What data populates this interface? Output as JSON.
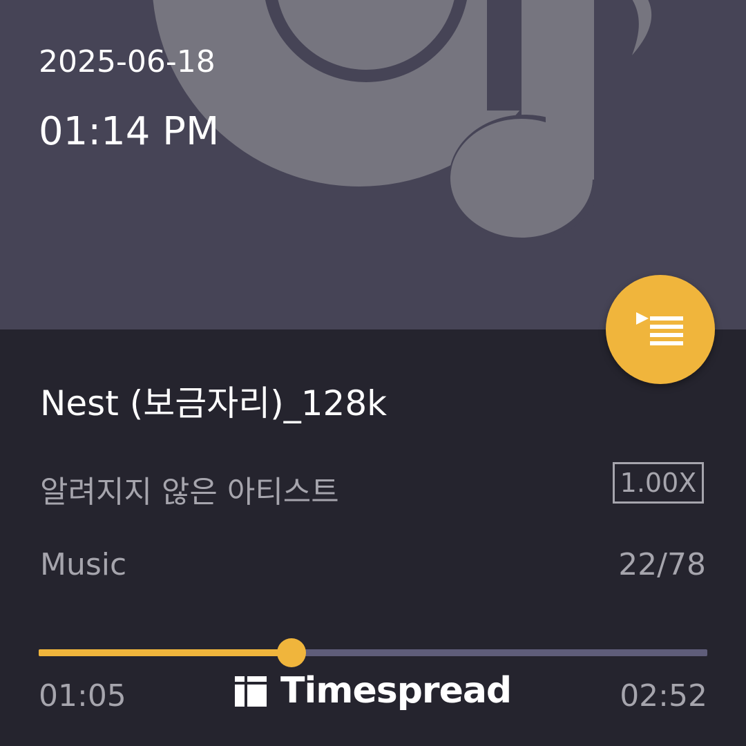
{
  "header": {
    "date": "2025-06-18",
    "time": "01:14 PM"
  },
  "album_art": {
    "icon": "music-note-icon"
  },
  "queue_button": {
    "icon": "queue-music-icon"
  },
  "track": {
    "title": "Nest (보금자리)_128k",
    "artist": "알려지지 않은 아티스트",
    "playback_speed": "1.00X",
    "album": "Music",
    "position_in_list": "22/78"
  },
  "progress": {
    "elapsed": "01:05",
    "duration": "02:52",
    "fraction": 0.378
  },
  "watermark": {
    "text": "Timespread",
    "icon": "timespread-logo-icon"
  },
  "colors": {
    "accent": "#f0b53c",
    "art_background": "#464456",
    "background": "#25242e",
    "track_remaining": "#5f5d7a"
  }
}
